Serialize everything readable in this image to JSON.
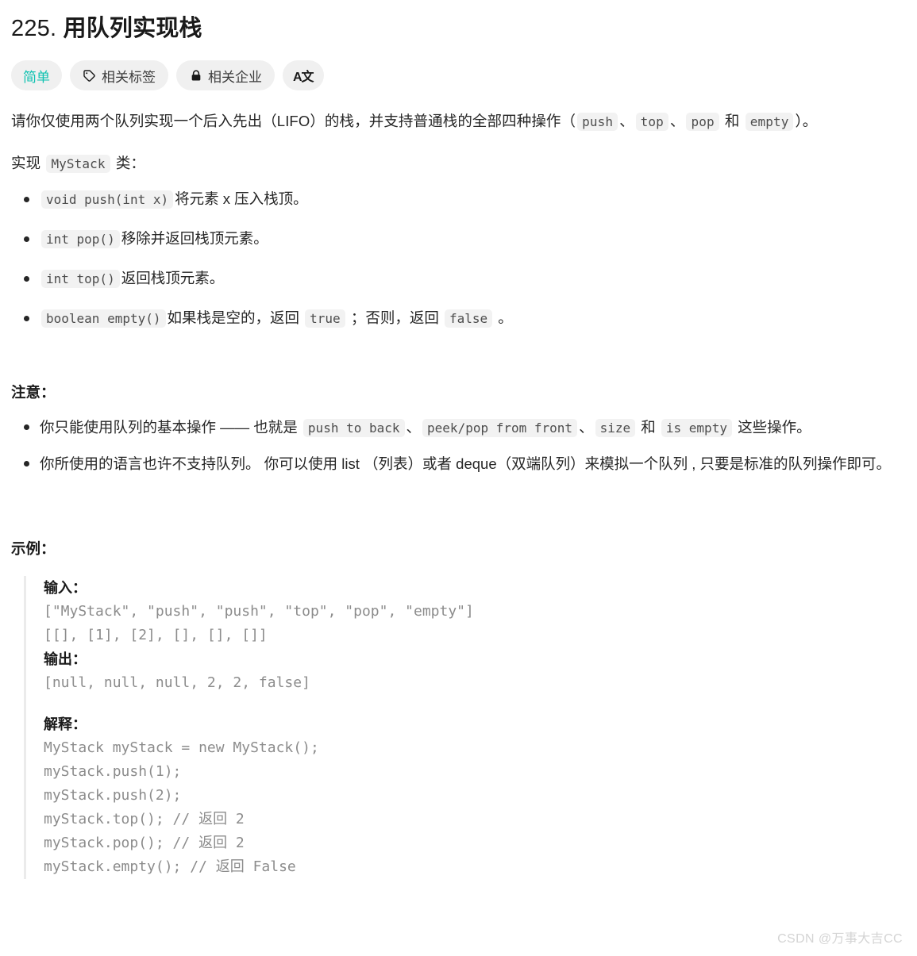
{
  "problem": {
    "number": "225.",
    "title": "用队列实现栈"
  },
  "pills": [
    {
      "label": "简单",
      "icon": null,
      "name": "difficulty-badge"
    },
    {
      "label": "相关标签",
      "icon": "tag-icon",
      "name": "related-tags-button"
    },
    {
      "label": "相关企业",
      "icon": "lock-icon",
      "name": "related-companies-button"
    },
    {
      "label": "A文",
      "icon": "translate-icon",
      "name": "translate-button"
    }
  ],
  "description": {
    "lead_1": "请你仅使用两个队列实现一个后入先出（LIFO）的栈，并支持普通栈的全部四种操作（",
    "code_push": "push",
    "sep_1": "、",
    "code_top": "top",
    "sep_2": "、",
    "code_pop": "pop",
    "sep_3": " 和 ",
    "code_empty": "empty",
    "lead_1_end": "）。",
    "lead_2_pre": "实现 ",
    "code_mystack": "MyStack",
    "lead_2_post": " 类："
  },
  "methods": [
    {
      "code": "void push(int x)",
      "text": "将元素 x 压入栈顶。"
    },
    {
      "code": "int pop()",
      "text": "移除并返回栈顶元素。"
    },
    {
      "code": "int top()",
      "text": "返回栈顶元素。"
    }
  ],
  "method_empty": {
    "code": "boolean empty()",
    "text_pre": "如果栈是空的，返回 ",
    "code_true": "true",
    "text_mid": " ；否则，返回 ",
    "code_false": "false",
    "text_end": " 。"
  },
  "notes": {
    "heading": "注意：",
    "item1": {
      "pre": "你只能使用队列的基本操作 —— 也就是 ",
      "code_1": "push to back",
      "sep_1": "、",
      "code_2": "peek/pop from front",
      "sep_2": "、",
      "code_3": "size",
      "sep_3": " 和 ",
      "code_4": "is empty",
      "post": " 这些操作。"
    },
    "item2": "你所使用的语言也许不支持队列。 你可以使用 list （列表）或者 deque（双端队列）来模拟一个队列 , 只要是标准的队列操作即可。"
  },
  "examples": {
    "heading": "示例：",
    "input_label": "输入：",
    "input_lines": [
      "[\"MyStack\", \"push\", \"push\", \"top\", \"pop\", \"empty\"]",
      "[[], [1], [2], [], [], []]"
    ],
    "output_label": "输出：",
    "output_lines": [
      "[null, null, null, 2, 2, false]"
    ],
    "explain_label": "解释：",
    "explain_lines": [
      "MyStack myStack = new MyStack();",
      "myStack.push(1);",
      "myStack.push(2);",
      "myStack.top(); // 返回 2",
      "myStack.pop(); // 返回 2",
      "myStack.empty(); // 返回 False"
    ]
  },
  "watermark": "CSDN @万事大吉CC",
  "colors": {
    "difficulty": "#0fc2b1",
    "pill_bg": "#f0f0f0",
    "inline_code_bg": "#f2f2f2",
    "code_text": "#8c8c8c",
    "border": "#ebebeb"
  }
}
